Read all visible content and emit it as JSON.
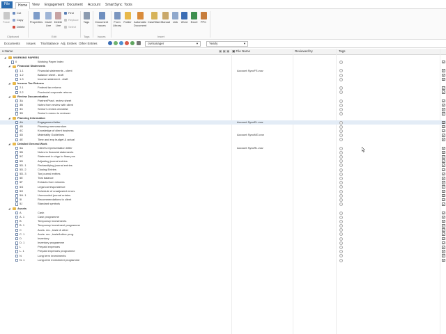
{
  "menu": {
    "tabs": [
      "File",
      "Home",
      "View",
      "Engagement",
      "Document",
      "Account",
      "SmartSync",
      "Tools"
    ],
    "active": "Home"
  },
  "ribbon": {
    "clipboard": {
      "paste": "Paste",
      "cut": "Cut",
      "copy": "Copy",
      "delete": "Delete",
      "group": "Clipboard"
    },
    "edit": {
      "properties": "Properties",
      "insert_line": "Insert Line",
      "delete_line": "Delete Line",
      "find": "Find",
      "replace": "Replace",
      "select": "Select",
      "group": "Edit"
    },
    "tags": {
      "tags": "Tags",
      "group": "Tags"
    },
    "issues": {
      "document_issues": "Document Issues",
      "group": "Issues"
    },
    "insert": {
      "items": [
        "From Library",
        "Folder",
        "Automatic Document",
        "CaseWare",
        "Manual",
        "Link",
        "Word",
        "Excel",
        "PPC"
      ],
      "group": "Insert"
    }
  },
  "toolbar": {
    "items": [
      "Documents",
      "Issues",
      "Trial Balance",
      "Adj. Entries",
      "Other Entries"
    ],
    "user_select": "cwmanager",
    "period_select": "Yearly"
  },
  "columns": {
    "name": "Name",
    "file_name": "File Name",
    "reviewed_by": "Reviewed by",
    "tags": "Tags"
  },
  "colors": {
    "accent": "#2b6cb0",
    "folder": "#e8b84a",
    "selection": "#e3ecf6"
  },
  "rows": [
    {
      "level": 0,
      "type": "folder",
      "ref": "",
      "name": "WORKING PAPERS",
      "file": "",
      "checked": false
    },
    {
      "level": 1,
      "type": "doc",
      "ref": "0",
      "name": "Working Paper Index",
      "file": "",
      "checked": true
    },
    {
      "level": 1,
      "type": "folder",
      "ref": "",
      "name": "Financial Statements",
      "file": "",
      "checked": false
    },
    {
      "level": 2,
      "type": "doc",
      "ref": "1.1",
      "name": "Financial statements - client",
      "file": "Account SyncFS.cvw",
      "checked": true
    },
    {
      "level": 2,
      "type": "doc",
      "ref": "1.2",
      "name": "Balance sheet - draft",
      "file": "",
      "checked": true
    },
    {
      "level": 2,
      "type": "doc",
      "ref": "1.3",
      "name": "Income statement - draft",
      "file": "",
      "checked": true
    },
    {
      "level": 1,
      "type": "folder",
      "ref": "",
      "name": "Income Tax Returns",
      "file": "",
      "checked": false
    },
    {
      "level": 2,
      "type": "doc",
      "ref": "2.1",
      "name": "Federal tax returns",
      "file": "",
      "checked": true
    },
    {
      "level": 2,
      "type": "doc",
      "ref": "2.2",
      "name": "Provincial corporate returns",
      "file": "",
      "checked": true
    },
    {
      "level": 1,
      "type": "folder",
      "ref": "",
      "name": "Review Documentation",
      "file": "",
      "checked": false
    },
    {
      "level": 2,
      "type": "doc",
      "ref": "3A",
      "name": "Partner/Pract. review sheet",
      "file": "",
      "checked": true
    },
    {
      "level": 2,
      "type": "doc",
      "ref": "3B",
      "name": "Notes from review with client",
      "file": "",
      "checked": true
    },
    {
      "level": 2,
      "type": "doc",
      "ref": "3C",
      "name": "Senior's review checklist",
      "file": "",
      "checked": true
    },
    {
      "level": 2,
      "type": "doc",
      "ref": "3D",
      "name": "Senior's memo to reviewer",
      "file": "",
      "checked": true
    },
    {
      "level": 1,
      "type": "folder",
      "ref": "",
      "name": "Planning Information",
      "file": "",
      "checked": false
    },
    {
      "level": 2,
      "type": "doc",
      "ref": "4A",
      "name": "Engagement letter",
      "file": "Account SyncEL.cvw",
      "checked": true,
      "selected": true
    },
    {
      "level": 2,
      "type": "doc",
      "ref": "4B",
      "name": "Planning memorandum",
      "file": "",
      "checked": true
    },
    {
      "level": 2,
      "type": "doc",
      "ref": "4C",
      "name": "Knowledge of client business",
      "file": "",
      "checked": true
    },
    {
      "level": 2,
      "type": "doc",
      "ref": "4D",
      "name": "Materiality Guidelines",
      "file": "Account SyncMG.cvw",
      "checked": true
    },
    {
      "level": 2,
      "type": "doc",
      "ref": "4E",
      "name": "Time and exp budget & actual",
      "file": "",
      "checked": true
    },
    {
      "level": 1,
      "type": "folder",
      "ref": "",
      "name": "Detailed General Work",
      "file": "",
      "checked": false
    },
    {
      "level": 2,
      "type": "doc",
      "ref": "5A",
      "name": "Client's representation letter",
      "file": "Account SyncRL.cvw",
      "checked": true
    },
    {
      "level": 2,
      "type": "doc",
      "ref": "5B",
      "name": "Notes to financial statements",
      "file": "",
      "checked": true
    },
    {
      "level": 2,
      "type": "doc",
      "ref": "5C",
      "name": "Statement in chgs to finan pos",
      "file": "",
      "checked": true
    },
    {
      "level": 2,
      "type": "doc",
      "ref": "5D",
      "name": "Adjusting journal entries",
      "file": "",
      "checked": true
    },
    {
      "level": 2,
      "type": "doc",
      "ref": "5D. 1",
      "name": "Reclassifying journal entries",
      "file": "",
      "checked": true
    },
    {
      "level": 2,
      "type": "doc",
      "ref": "5D. 2",
      "name": "Closing Entries",
      "file": "",
      "checked": true
    },
    {
      "level": 2,
      "type": "doc",
      "ref": "5D. 3",
      "name": "Tax journal entries",
      "file": "",
      "checked": true
    },
    {
      "level": 2,
      "type": "doc",
      "ref": "5E",
      "name": "Trial balance",
      "file": "",
      "checked": true
    },
    {
      "level": 2,
      "type": "doc",
      "ref": "5F",
      "name": "Extracts from minutes",
      "file": "",
      "checked": true
    },
    {
      "level": 2,
      "type": "doc",
      "ref": "5G",
      "name": "Legal correspondence",
      "file": "",
      "checked": true
    },
    {
      "level": 2,
      "type": "doc",
      "ref": "5H",
      "name": "Schedule of unadjusted errors",
      "file": "",
      "checked": true
    },
    {
      "level": 2,
      "type": "doc",
      "ref": "5H. 1",
      "name": "Unrecorded journal entries",
      "file": "",
      "checked": true
    },
    {
      "level": 2,
      "type": "doc",
      "ref": "5I",
      "name": "Recommendations to client",
      "file": "",
      "checked": true
    },
    {
      "level": 2,
      "type": "doc",
      "ref": "5J",
      "name": "Standard symbols",
      "file": "",
      "checked": true
    },
    {
      "level": 1,
      "type": "folder",
      "ref": "",
      "name": "Assets",
      "file": "",
      "checked": false
    },
    {
      "level": 2,
      "type": "doc",
      "ref": "A",
      "name": "Cash",
      "file": "",
      "checked": true
    },
    {
      "level": 2,
      "type": "doc",
      "ref": "A. 1",
      "name": "Cash programme",
      "file": "",
      "checked": true
    },
    {
      "level": 2,
      "type": "doc",
      "ref": "B",
      "name": "Temporary investments",
      "file": "",
      "checked": true
    },
    {
      "level": 2,
      "type": "doc",
      "ref": "B. 1",
      "name": "Temporary investment programme",
      "file": "",
      "checked": true
    },
    {
      "level": 2,
      "type": "doc",
      "ref": "C",
      "name": "Accts. rec., trade & other",
      "file": "",
      "checked": true
    },
    {
      "level": 2,
      "type": "doc",
      "ref": "C. 1",
      "name": "Accts. rec., trade&other prog.",
      "file": "",
      "checked": true
    },
    {
      "level": 2,
      "type": "doc",
      "ref": "D",
      "name": "Inventory",
      "file": "",
      "checked": true
    },
    {
      "level": 2,
      "type": "doc",
      "ref": "D. 1",
      "name": "Inventory programme",
      "file": "",
      "checked": true
    },
    {
      "level": 2,
      "type": "doc",
      "ref": "L",
      "name": "Prepaid expenses",
      "file": "",
      "checked": true
    },
    {
      "level": 2,
      "type": "doc",
      "ref": "L. 1",
      "name": "Prepaid expenses programme",
      "file": "",
      "checked": true
    },
    {
      "level": 2,
      "type": "doc",
      "ref": "N",
      "name": "Long term investments",
      "file": "",
      "checked": true
    },
    {
      "level": 2,
      "type": "doc",
      "ref": "N. 1",
      "name": "Long-term investment programme",
      "file": "",
      "checked": true
    }
  ]
}
